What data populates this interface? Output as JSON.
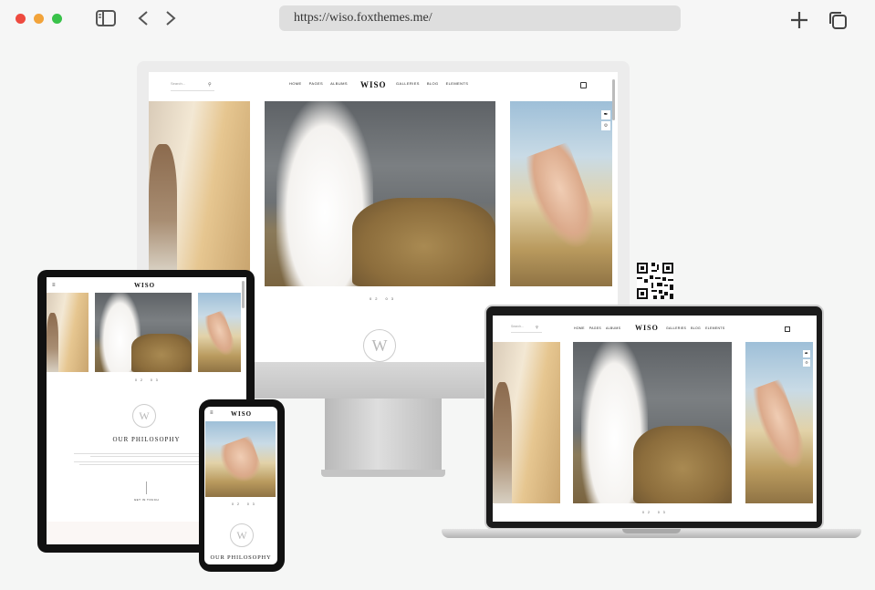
{
  "browser": {
    "url": "https://wiso.foxthemes.me/"
  },
  "site": {
    "logo": "WISO",
    "search_placeholder": "Search...",
    "nav": [
      "HOME",
      "PAGES",
      "ALBUMS",
      "GALLERIES",
      "BLOG",
      "ELEMENTS"
    ],
    "pager": "02    03",
    "emblem_letter": "W",
    "philosophy_heading": "OUR PHILOSOPHY",
    "get_in_touch": "GET IN TOUCH"
  },
  "colors": {
    "accent": "#222222",
    "frame": "#111111",
    "stand": "#c8c8c8"
  }
}
